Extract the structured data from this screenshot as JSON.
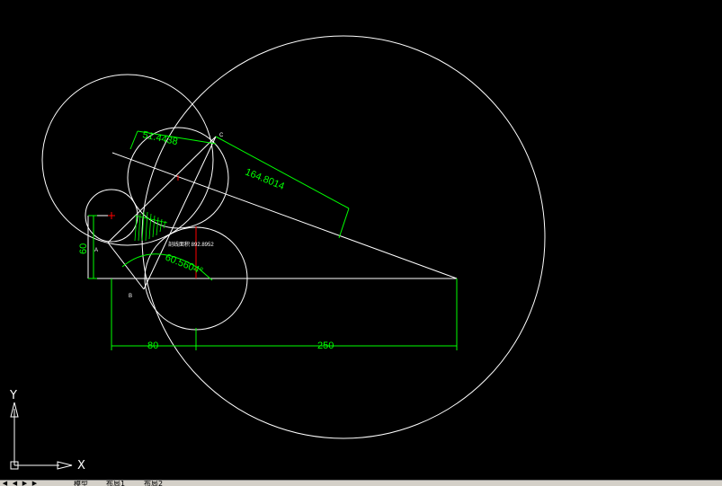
{
  "drawing": {
    "dimensions": {
      "height_left": "60",
      "length_80": "80",
      "length_250": "250",
      "aligned_small": "51.4438",
      "aligned_long": "164.8014",
      "angle": "60.5604°"
    },
    "points": {
      "a": "A",
      "b": "B",
      "c": "C"
    },
    "hatch_note": "剖线面积 892.8952"
  },
  "ucs": {
    "x_label": "X",
    "y_label": "Y"
  },
  "layout_tabs": {
    "model": "模型",
    "layout1": "布局1",
    "layout2": "布局2"
  },
  "colors": {
    "background": "#000000",
    "geometry": "#ffffff",
    "dimension": "#00ff00",
    "center_mark": "#ff0000"
  }
}
